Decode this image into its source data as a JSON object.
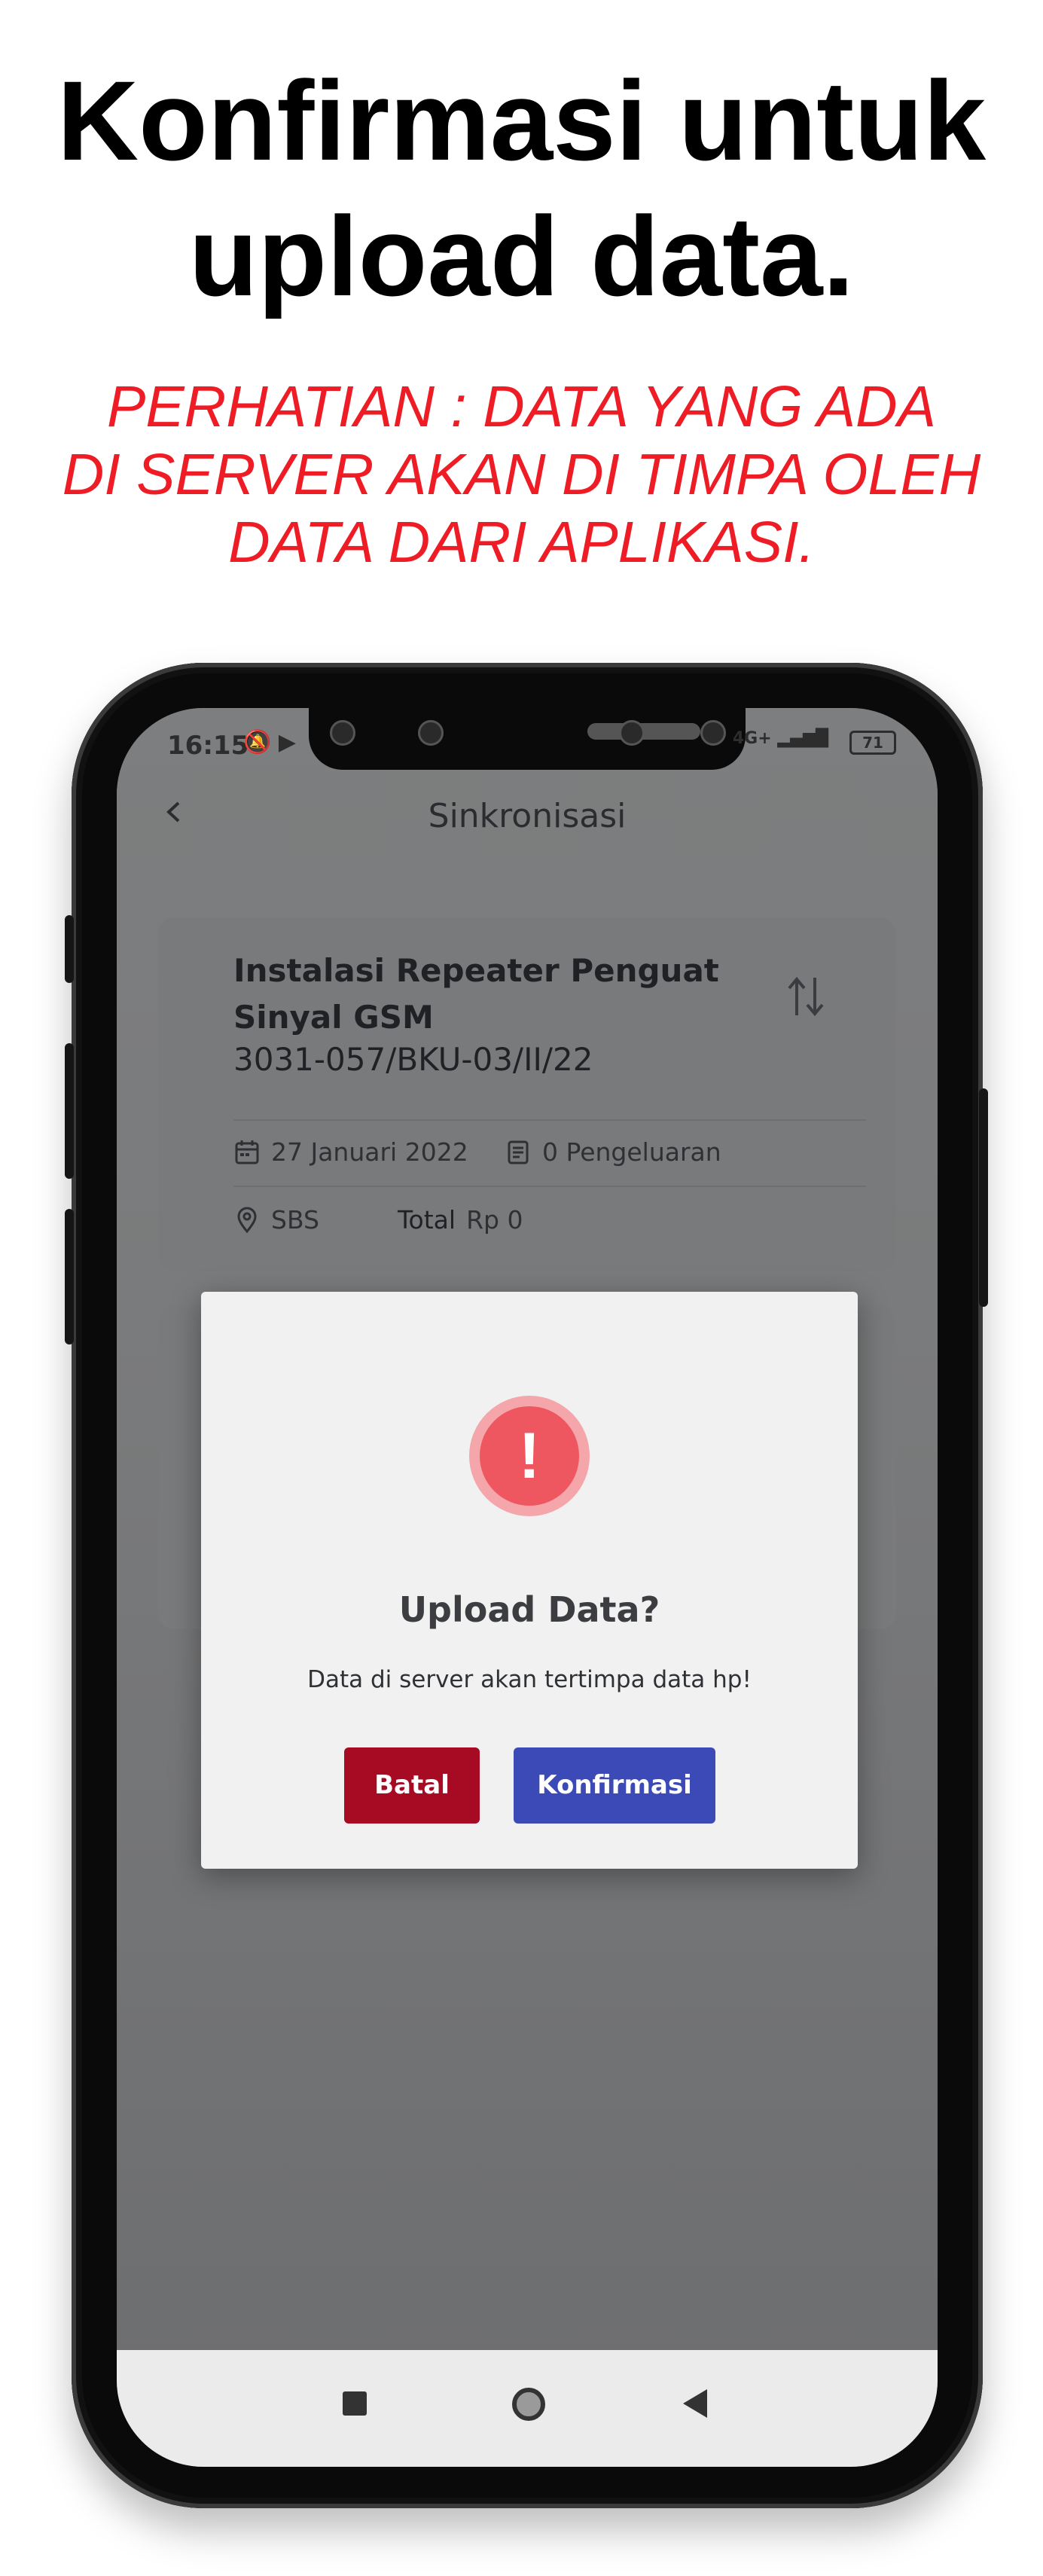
{
  "headline": {
    "line1": "Konfirmasi untuk",
    "line2": "upload data."
  },
  "warning": "PERHATIAN : DATA YANG ADA\nDI SERVER AKAN DI TIMPA OLEH\nDATA DARI APLIKASI.",
  "status_bar": {
    "time": "16:15",
    "network": "4G+",
    "battery": "71"
  },
  "app_bar": {
    "title": "Sinkronisasi",
    "back_icon": "chevron-left-icon"
  },
  "card": {
    "title": "Instalasi Repeater Penguat Sinyal GSM",
    "code": "3031-057/BKU-03/II/22",
    "date": "27 Januari 2022",
    "expenses": "0 Pengeluaran",
    "location": "SBS",
    "total_label": "Total",
    "total_value": "Rp 0",
    "icons": [
      "sync-arrows-icon",
      "calendar-icon",
      "receipt-icon",
      "location-pin-icon"
    ]
  },
  "modal": {
    "icon": "exclamation-icon",
    "title": "Upload Data?",
    "message": "Data di server akan tertimpa data hp!",
    "cancel_label": "Batal",
    "confirm_label": "Konfirmasi",
    "colors": {
      "cancel": "#a70a23",
      "confirm": "#3c4ab8",
      "alert": "#ee5760"
    }
  },
  "nav_bar": {
    "icons": [
      "recent-apps-icon",
      "home-icon",
      "back-icon"
    ]
  }
}
